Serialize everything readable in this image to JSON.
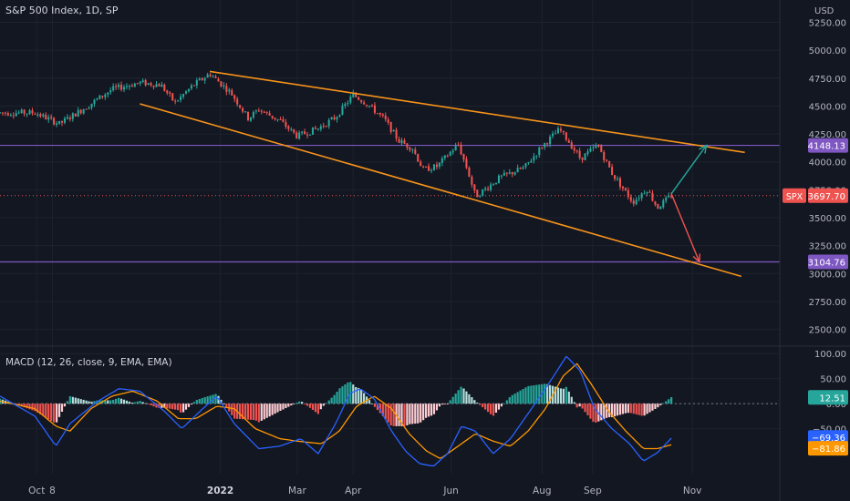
{
  "header": {
    "title": "S&P 500 Index, 1D, SP",
    "currency": "USD"
  },
  "macd_label": "MACD (12, 26, close, 9, EMA, EMA)",
  "colors": {
    "background": "#131722",
    "up": "#26a69a",
    "down": "#ef5350",
    "channel": "#f7931a",
    "level": "#7e57c2",
    "macd": "#2962ff",
    "signal": "#ff9800",
    "grid": "#1e222d",
    "text": "#b2b5be"
  },
  "price_tags": {
    "resistance": {
      "label": "4148.13",
      "value": 4148.13
    },
    "current": {
      "symbol": "SPX",
      "label": "3697.70",
      "value": 3697.7
    },
    "support": {
      "label": "3104.76",
      "value": 3104.76
    }
  },
  "macd_tags": {
    "hist": {
      "label": "12.51",
      "value": 12.51
    },
    "macd": {
      "label": "−69.36",
      "value": -69.36
    },
    "signal": {
      "label": "−81.86",
      "value": -81.86
    }
  },
  "chart_data": [
    {
      "type": "candlestick",
      "title": "S&P 500 Index, 1D, SP",
      "ylabel": "USD",
      "yticks": [
        2500,
        2750,
        3000,
        3250,
        3500,
        3750,
        4000,
        4250,
        4500,
        4750,
        5000,
        5250
      ],
      "ytick_labels": [
        "2500.00",
        "2750.00",
        "3000.00",
        "3250.00",
        "3500.00",
        "3750.00",
        "4000.00",
        "4250.00",
        "4500.00",
        "4750.00",
        "5000.00",
        "5250.00"
      ],
      "ylim": [
        2350,
        5450
      ],
      "xticks": [
        "Oct",
        "8",
        "2022",
        "Mar",
        "Apr",
        "Jun",
        "Aug",
        "Sep",
        "Nov"
      ],
      "xtick_pos": [
        0.05,
        0.5,
        5.3,
        7.5,
        9.1,
        11.9,
        14.5,
        15.95,
        18.8
      ],
      "xlim": [
        -1,
        21.3
      ],
      "price_keypoints": [
        [
          0,
          4440
        ],
        [
          0.7,
          4340
        ],
        [
          1,
          4400
        ],
        [
          1.5,
          4500
        ],
        [
          2.2,
          4650
        ],
        [
          3,
          4710
        ],
        [
          3.6,
          4690
        ],
        [
          4,
          4530
        ],
        [
          4.5,
          4680
        ],
        [
          5,
          4790
        ],
        [
          5.6,
          4620
        ],
        [
          6.1,
          4390
        ],
        [
          6.4,
          4470
        ],
        [
          7,
          4370
        ],
        [
          7.5,
          4230
        ],
        [
          8.1,
          4300
        ],
        [
          8.6,
          4400
        ],
        [
          9.1,
          4600
        ],
        [
          9.5,
          4520
        ],
        [
          10,
          4380
        ],
        [
          10.4,
          4190
        ],
        [
          10.8,
          4120
        ],
        [
          11.1,
          3930
        ],
        [
          11.5,
          3960
        ],
        [
          12.1,
          4160
        ],
        [
          12.4,
          3900
        ],
        [
          12.6,
          3690
        ],
        [
          13.3,
          3860
        ],
        [
          14,
          3950
        ],
        [
          14.5,
          4140
        ],
        [
          15,
          4290
        ],
        [
          15.2,
          4210
        ],
        [
          15.6,
          4030
        ],
        [
          16.1,
          4150
        ],
        [
          16.5,
          3900
        ],
        [
          17.1,
          3640
        ],
        [
          17.5,
          3760
        ],
        [
          17.8,
          3590
        ],
        [
          18.2,
          3700
        ]
      ],
      "channel_upper": {
        "from": {
          "x": 5.0,
          "y": 4810
        },
        "to": {
          "x": 20.3,
          "y": 4085
        }
      },
      "channel_lower": {
        "from": {
          "x": 3.0,
          "y": 4520
        },
        "to": {
          "x": 20.2,
          "y": 2975
        }
      },
      "horizontal_levels": [
        4148.13,
        3104.76
      ],
      "current_price_line": 3697.7,
      "projection_up": {
        "from": {
          "x": 18.2,
          "y": 3715
        },
        "to": {
          "x": 19.2,
          "y": 4148
        }
      },
      "projection_down": {
        "from": {
          "x": 18.2,
          "y": 3715
        },
        "to": {
          "x": 19.0,
          "y": 3105
        }
      }
    },
    {
      "type": "macd",
      "title": "MACD (12, 26, close, 9, EMA, EMA)",
      "series": [
        {
          "name": "MACD"
        },
        {
          "name": "Signal"
        },
        {
          "name": "Histogram"
        }
      ],
      "yticks": [
        100,
        50,
        0,
        -50
      ],
      "ytick_labels": [
        "100.00",
        "50.00",
        "0.00",
        "−50.00"
      ],
      "ylim": [
        -140,
        115
      ],
      "macd_keypoints": [
        [
          -1,
          15
        ],
        [
          0,
          -25
        ],
        [
          0.6,
          -85
        ],
        [
          1,
          -40
        ],
        [
          1.8,
          5
        ],
        [
          2.4,
          30
        ],
        [
          3,
          25
        ],
        [
          3.7,
          -15
        ],
        [
          4.2,
          -50
        ],
        [
          4.8,
          -10
        ],
        [
          5.2,
          15
        ],
        [
          5.7,
          -40
        ],
        [
          6.4,
          -90
        ],
        [
          7,
          -85
        ],
        [
          7.6,
          -70
        ],
        [
          8.1,
          -100
        ],
        [
          8.6,
          -40
        ],
        [
          9,
          20
        ],
        [
          9.3,
          30
        ],
        [
          9.7,
          10
        ],
        [
          10.2,
          -55
        ],
        [
          10.6,
          -95
        ],
        [
          11,
          -120
        ],
        [
          11.4,
          -125
        ],
        [
          11.8,
          -100
        ],
        [
          12.2,
          -45
        ],
        [
          12.6,
          -55
        ],
        [
          13.1,
          -100
        ],
        [
          13.6,
          -70
        ],
        [
          14.1,
          -20
        ],
        [
          14.6,
          30
        ],
        [
          15.2,
          95
        ],
        [
          15.6,
          65
        ],
        [
          16,
          -10
        ],
        [
          16.5,
          -50
        ],
        [
          17,
          -80
        ],
        [
          17.4,
          -115
        ],
        [
          17.8,
          -98
        ],
        [
          18.2,
          -69
        ]
      ],
      "signal_keypoints": [
        [
          -1,
          5
        ],
        [
          0,
          -10
        ],
        [
          0.6,
          -45
        ],
        [
          1,
          -55
        ],
        [
          1.6,
          -10
        ],
        [
          2.2,
          15
        ],
        [
          2.8,
          25
        ],
        [
          3.5,
          5
        ],
        [
          4.1,
          -30
        ],
        [
          4.6,
          -30
        ],
        [
          5.2,
          -5
        ],
        [
          5.7,
          -10
        ],
        [
          6.3,
          -50
        ],
        [
          7,
          -70
        ],
        [
          7.5,
          -75
        ],
        [
          8.2,
          -80
        ],
        [
          8.7,
          -55
        ],
        [
          9.2,
          -5
        ],
        [
          9.7,
          15
        ],
        [
          10.2,
          -10
        ],
        [
          10.7,
          -60
        ],
        [
          11.2,
          -95
        ],
        [
          11.6,
          -110
        ],
        [
          12.1,
          -85
        ],
        [
          12.6,
          -60
        ],
        [
          13.1,
          -75
        ],
        [
          13.6,
          -85
        ],
        [
          14.1,
          -55
        ],
        [
          14.6,
          -10
        ],
        [
          15.1,
          55
        ],
        [
          15.5,
          80
        ],
        [
          15.9,
          40
        ],
        [
          16.4,
          -15
        ],
        [
          16.9,
          -55
        ],
        [
          17.4,
          -90
        ],
        [
          17.8,
          -90
        ],
        [
          18.2,
          -82
        ]
      ]
    }
  ]
}
